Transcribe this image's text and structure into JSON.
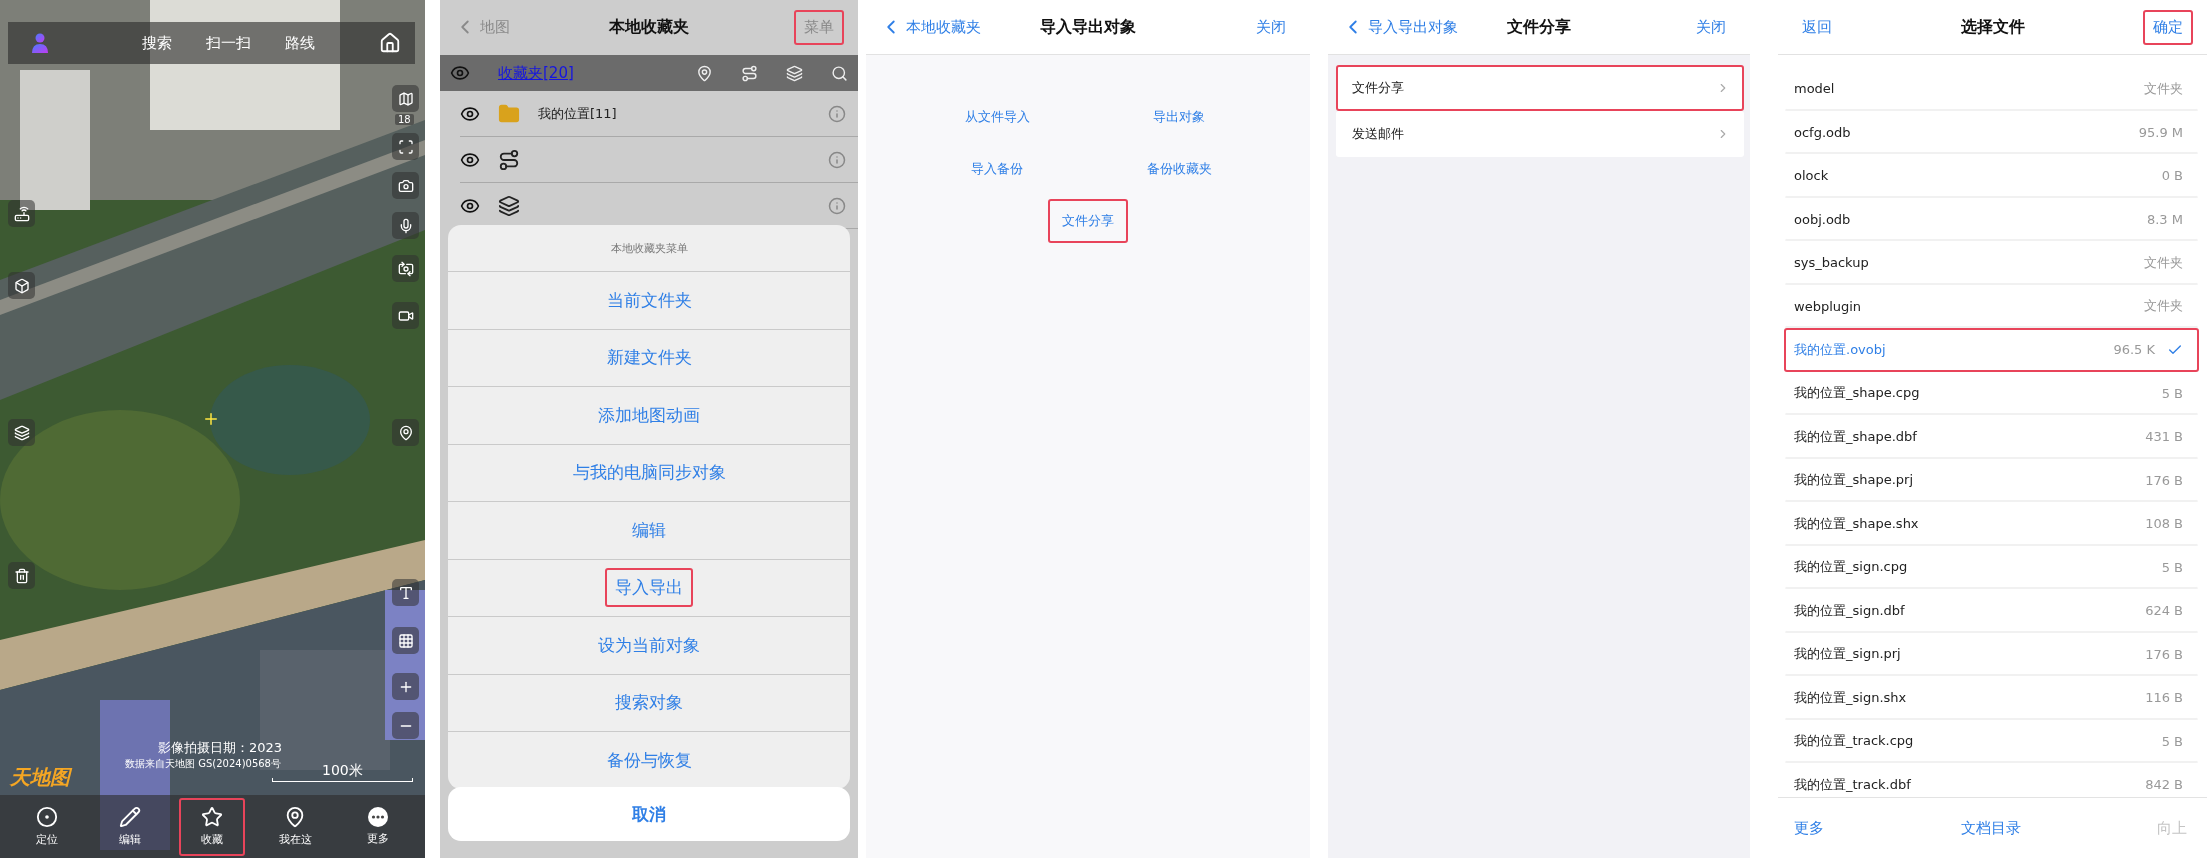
{
  "map_screen": {
    "top_tabs": [
      {
        "label": "搜索"
      },
      {
        "label": "扫一扫"
      },
      {
        "label": "路线"
      }
    ],
    "zoom_level": "18",
    "capture_date": "影像拍摄日期：2023",
    "attribution": "数据来自天地图 GS(2024)0568号",
    "logo": "天地图",
    "scale": "100米",
    "bottom_tabs": [
      {
        "label": "定位",
        "highlighted": false
      },
      {
        "label": "编辑",
        "highlighted": false
      },
      {
        "label": "收藏",
        "highlighted": true
      },
      {
        "label": "我在这",
        "highlighted": false
      },
      {
        "label": "更多",
        "highlighted": false
      }
    ]
  },
  "favorites_screen": {
    "back": "地图",
    "title": "本地收藏夹",
    "menu_button": {
      "label": "菜单",
      "highlighted": true
    },
    "folder_link": "收藏夹[20]",
    "rows": [
      {
        "kind": "folder",
        "label": "我的位置[11]"
      },
      {
        "kind": "route"
      },
      {
        "kind": "shape"
      }
    ],
    "menu": {
      "title": "本地收藏夹菜单",
      "items": [
        {
          "label": "当前文件夹",
          "highlighted": false
        },
        {
          "label": "新建文件夹",
          "highlighted": false
        },
        {
          "label": "添加地图动画",
          "highlighted": false
        },
        {
          "label": "与我的电脑同步对象",
          "highlighted": false
        },
        {
          "label": "编辑",
          "highlighted": false
        },
        {
          "label": "导入导出",
          "highlighted": true
        },
        {
          "label": "设为当前对象",
          "highlighted": false
        },
        {
          "label": "搜索对象",
          "highlighted": false
        },
        {
          "label": "备份与恢复",
          "highlighted": false
        }
      ],
      "cancel": "取消"
    }
  },
  "import_export_screen": {
    "back": "本地收藏夹",
    "title": "导入导出对象",
    "close": "关闭",
    "options": [
      {
        "label": "从文件导入",
        "highlighted": false
      },
      {
        "label": "导出对象",
        "highlighted": false
      },
      {
        "label": "导入备份",
        "highlighted": false
      },
      {
        "label": "备份收藏夹",
        "highlighted": false
      },
      {
        "label": "文件分享",
        "highlighted": true
      }
    ]
  },
  "file_share_screen": {
    "back": "导入导出对象",
    "title": "文件分享",
    "close": "关闭",
    "rows": [
      {
        "label": "文件分享",
        "highlighted": true
      },
      {
        "label": "发送邮件",
        "highlighted": false
      }
    ]
  },
  "file_picker": {
    "back": "返回",
    "title": "选择文件",
    "confirm": {
      "label": "确定",
      "highlighted": true
    },
    "files": [
      {
        "name": "model",
        "size": "文件夹",
        "selected": false
      },
      {
        "name": "ocfg.odb",
        "size": "95.9 M",
        "selected": false
      },
      {
        "name": "olock",
        "size": "0 B",
        "selected": false
      },
      {
        "name": "oobj.odb",
        "size": "8.3 M",
        "selected": false
      },
      {
        "name": "sys_backup",
        "size": "文件夹",
        "selected": false
      },
      {
        "name": "webplugin",
        "size": "文件夹",
        "selected": false
      },
      {
        "name": "我的位置.ovobj",
        "size": "96.5 K",
        "selected": true
      },
      {
        "name": "我的位置_shape.cpg",
        "size": "5 B",
        "selected": false
      },
      {
        "name": "我的位置_shape.dbf",
        "size": "431 B",
        "selected": false
      },
      {
        "name": "我的位置_shape.prj",
        "size": "176 B",
        "selected": false
      },
      {
        "name": "我的位置_shape.shx",
        "size": "108 B",
        "selected": false
      },
      {
        "name": "我的位置_sign.cpg",
        "size": "5 B",
        "selected": false
      },
      {
        "name": "我的位置_sign.dbf",
        "size": "624 B",
        "selected": false
      },
      {
        "name": "我的位置_sign.prj",
        "size": "176 B",
        "selected": false
      },
      {
        "name": "我的位置_sign.shx",
        "size": "116 B",
        "selected": false
      },
      {
        "name": "我的位置_track.cpg",
        "size": "5 B",
        "selected": false
      },
      {
        "name": "我的位置_track.dbf",
        "size": "842 B",
        "selected": false
      }
    ],
    "footer": [
      {
        "label": "更多",
        "disabled": false
      },
      {
        "label": "文档目录",
        "disabled": false
      },
      {
        "label": "向上",
        "disabled": true
      }
    ]
  }
}
